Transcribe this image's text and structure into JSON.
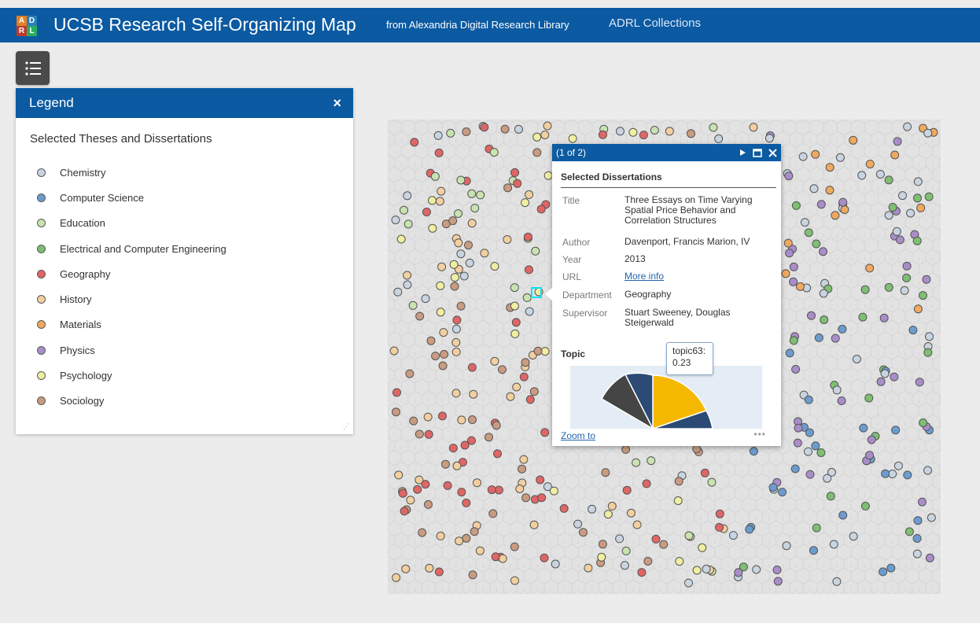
{
  "header": {
    "logo_letters": [
      "A",
      "D",
      "R",
      "L"
    ],
    "title": "UCSB Research Self-Organizing Map",
    "subtitle": "from Alexandria Digital Research Library",
    "collections_link": "ADRL Collections"
  },
  "legend_toggle": {
    "icon": "list-icon"
  },
  "legend": {
    "title": "Legend",
    "close_glyph": "×",
    "layer_title": "Selected Theses and Dissertations",
    "items": [
      {
        "label": "Chemistry",
        "color": "#c8d4e0"
      },
      {
        "label": "Computer Science",
        "color": "#6c9ccf"
      },
      {
        "label": "Education",
        "color": "#c9e3b0"
      },
      {
        "label": "Electrical and Computer Engineering",
        "color": "#7ebf72"
      },
      {
        "label": "Geography",
        "color": "#e06666"
      },
      {
        "label": "History",
        "color": "#f3cfa0"
      },
      {
        "label": "Materials",
        "color": "#f0a95f"
      },
      {
        "label": "Physics",
        "color": "#a98dc9"
      },
      {
        "label": "Psychology",
        "color": "#f0eea0"
      },
      {
        "label": "Sociology",
        "color": "#c99b80"
      }
    ]
  },
  "popup": {
    "count": "(1 of 2)",
    "title": "Selected Dissertations",
    "fields": [
      {
        "label": "Title",
        "value": "Three Essays on Time Varying Spatial Price Behavior and Correlation Structures"
      },
      {
        "label": "Author",
        "value": "Davenport, Francis Marion, IV"
      },
      {
        "label": "Year",
        "value": "2013"
      },
      {
        "label": "URL",
        "value": "More info"
      },
      {
        "label": "Department",
        "value": "Geography"
      },
      {
        "label": "Supervisor",
        "value": "Stuart Sweeney, Douglas Steigerwald"
      }
    ],
    "topic_title": "Topic",
    "tooltip": "topic63: 0.23",
    "zoom_label": "Zoom to",
    "more_glyph": "•••"
  },
  "chart_data": {
    "type": "pie",
    "slices": [
      {
        "name": "topic63",
        "value": 0.23,
        "color": "#f5b800"
      },
      {
        "name": "",
        "color": "#2b4a75"
      },
      {
        "name": "",
        "color": "#454545"
      }
    ]
  }
}
